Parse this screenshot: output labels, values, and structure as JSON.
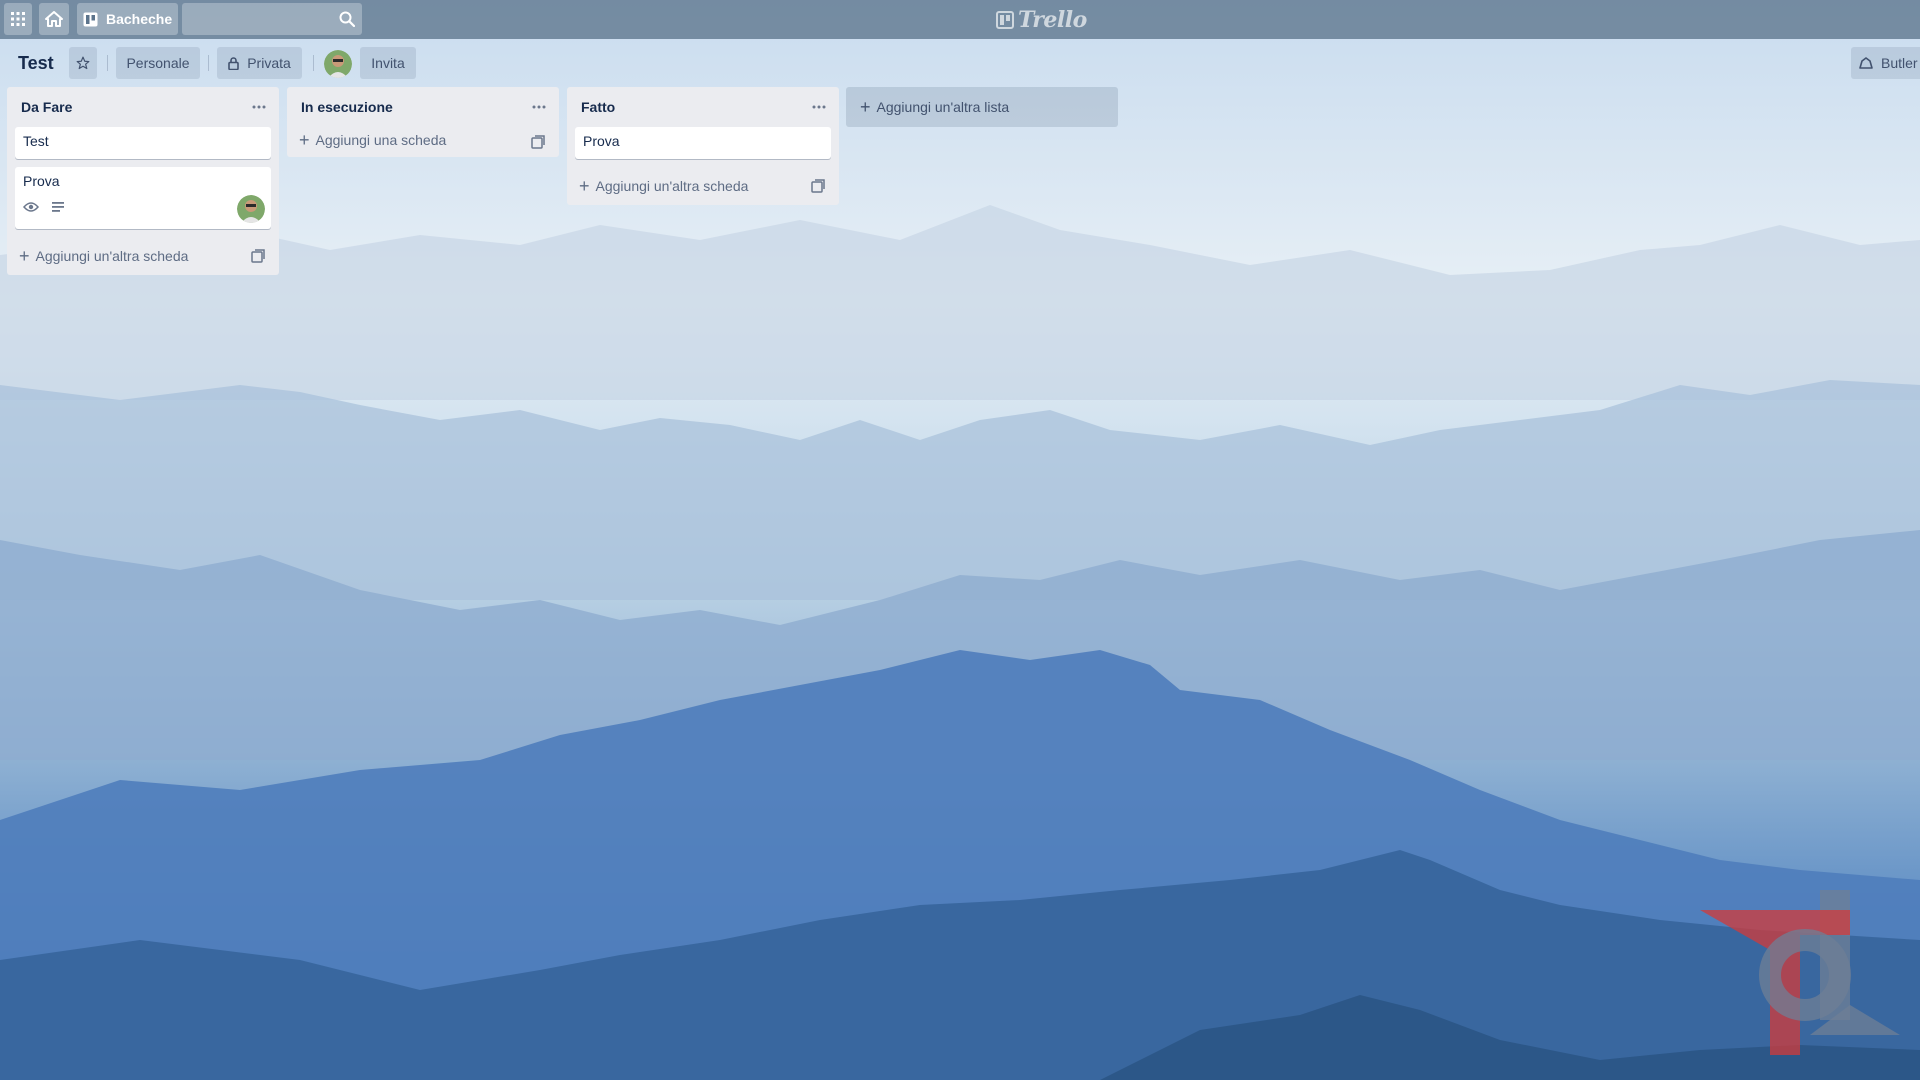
{
  "header": {
    "boards_label": "Bacheche",
    "search": {
      "value": "",
      "placeholder": ""
    },
    "logo_text": "Trello"
  },
  "board": {
    "title": "Test",
    "team_label": "Personale",
    "visibility_label": "Privata",
    "invite_label": "Invita",
    "butler_label": "Butler"
  },
  "lists": [
    {
      "title": "Da Fare",
      "cards": [
        {
          "title": "Test"
        },
        {
          "title": "Prova",
          "badges": [
            "eye-icon",
            "description-icon"
          ],
          "has_member": true
        }
      ],
      "add_card_label": "Aggiungi un'altra scheda"
    },
    {
      "title": "In esecuzione",
      "cards": [],
      "add_card_label": "Aggiungi una scheda"
    },
    {
      "title": "Fatto",
      "cards": [
        {
          "title": "Prova"
        }
      ],
      "add_card_label": "Aggiungi un'altra scheda"
    }
  ],
  "add_list_label": "Aggiungi un'altra lista",
  "colors": {
    "header_bar": "#5c748c",
    "list_bg": "#ebecf0",
    "text_primary": "#172b4d",
    "text_secondary": "#5e6c84"
  }
}
